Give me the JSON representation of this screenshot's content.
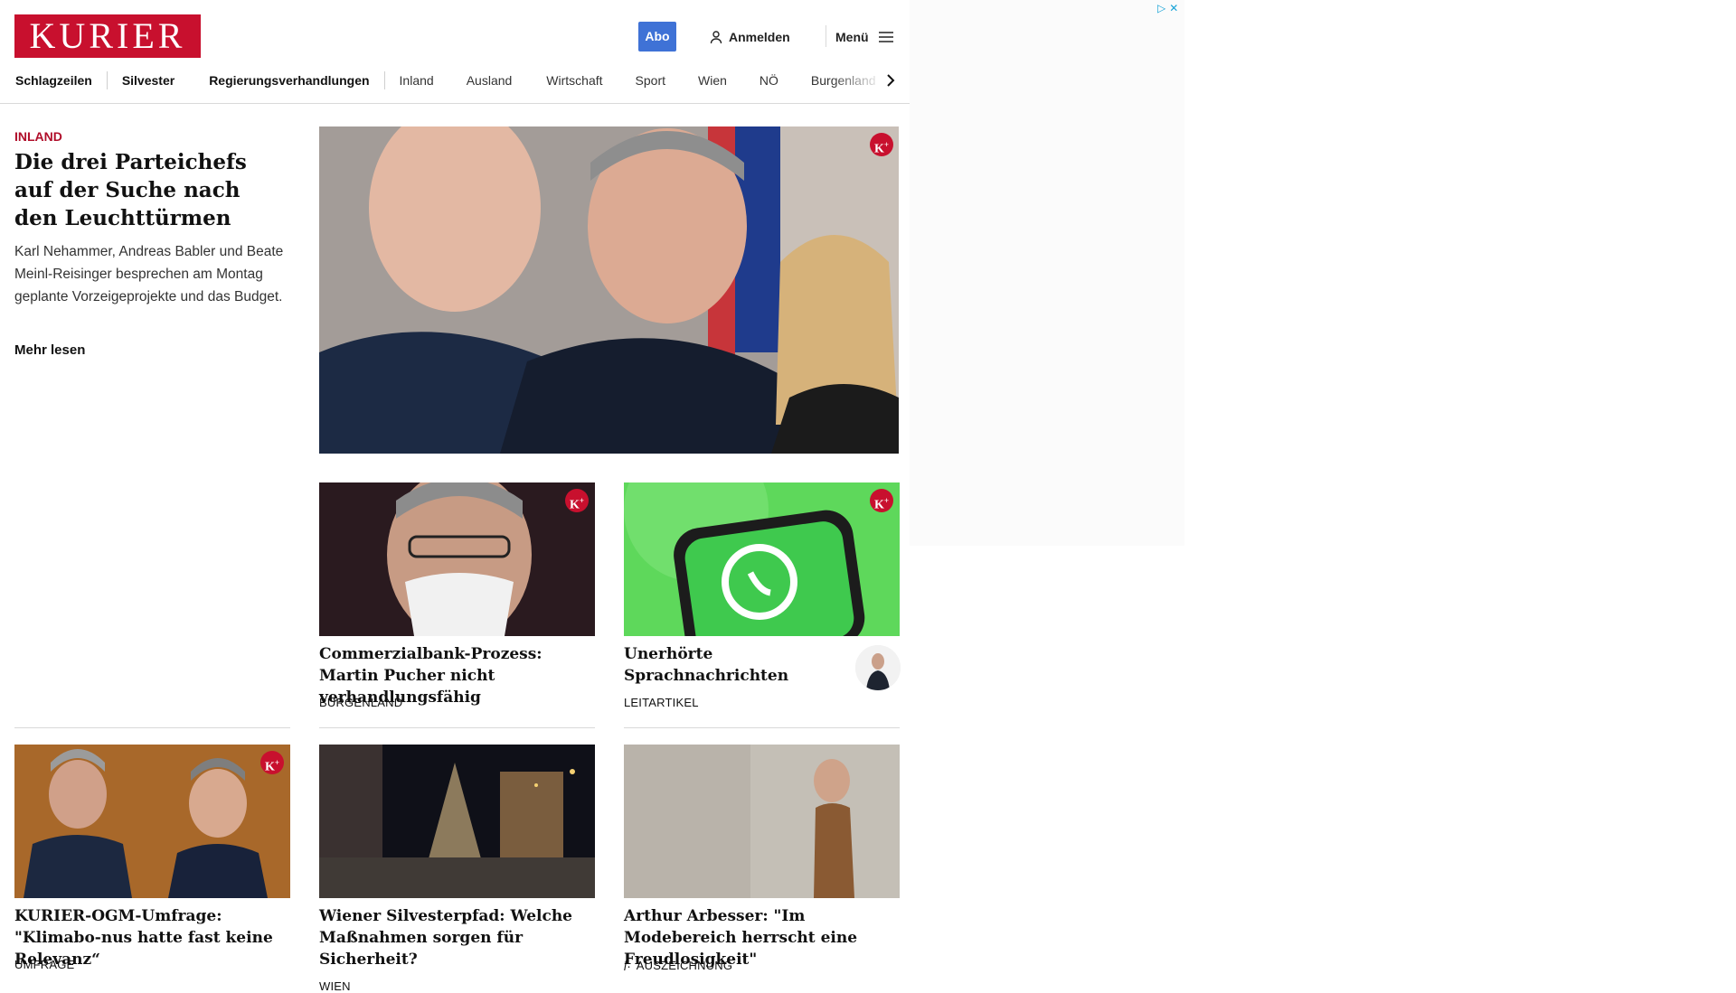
{
  "header": {
    "logo": "KURIER",
    "abo": "Abo",
    "login": "Anmelden",
    "menu": "Menü",
    "logo_color": "#c8102e",
    "abo_color": "#3f72d6"
  },
  "nav": {
    "items": [
      "Schlagzeilen",
      "Silvester",
      "Regierungsverhandlungen",
      "Inland",
      "Ausland",
      "Wirtschaft",
      "Sport",
      "Wien",
      "NÖ",
      "Burgenland"
    ]
  },
  "lead": {
    "kicker": "INLAND",
    "title": "Die drei Parteichefs auf der Suche nach den Leuchttürmen",
    "text": "Karl Nehammer, Andreas Babler und Beate Meinl-Reisinger besprechen am Montag geplante Vorzeigeprojekte und das Budget.",
    "more": "Mehr lesen",
    "premium_badge": "K+"
  },
  "cards": [
    {
      "title": "Commerzialbank-Prozess: Martin Pucher nicht verhandlungsfähig",
      "kicker": "BURGENLAND",
      "premium": "K+"
    },
    {
      "title": "Unerhörte Sprachnachrichten",
      "kicker": "LEITARTIKEL",
      "premium": "K+"
    },
    {
      "title": "KURIER-OGM-Umfrage: \"Klimabo-nus hatte fast keine Relevanz“",
      "kicker": "UMFRAGE",
      "premium": "K+"
    },
    {
      "title": "Wiener Silvesterpfad: Welche Maßnahmen sorgen für Sicherheit?",
      "kicker": "WIEN"
    },
    {
      "title": "Arthur Arbesser: \"Im Modebereich herrscht eine Freudlosigkeit\"",
      "kicker": "AUSZEICHNUNG",
      "kicker_icon": "freizeit-icon"
    }
  ],
  "ad": {
    "icons": [
      "adchoices-icon",
      "close-icon"
    ]
  }
}
